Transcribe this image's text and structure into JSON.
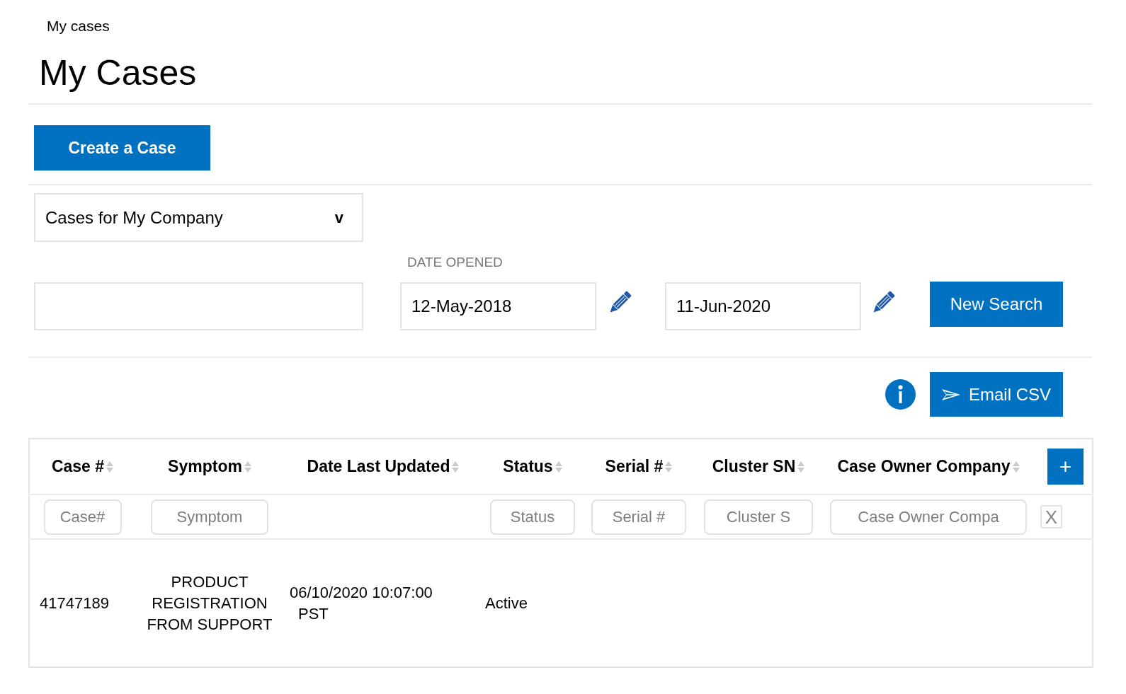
{
  "breadcrumb": "My cases",
  "page_title": "My Cases",
  "create_case_button": "Create a Case",
  "case_scope_dropdown": {
    "value": "Cases for My Company",
    "caret": "v"
  },
  "date_opened": {
    "label": "DATE OPENED",
    "from": "12-May-2018",
    "to": "11-Jun-2020"
  },
  "new_search_button": "New Search",
  "email_csv_button": "Email CSV",
  "table": {
    "columns": [
      {
        "label": "Case #",
        "filter_placeholder": "Case#"
      },
      {
        "label": "Symptom",
        "filter_placeholder": "Symptom"
      },
      {
        "label": "Date Last Updated"
      },
      {
        "label": "Status",
        "filter_placeholder": "Status"
      },
      {
        "label": "Serial #",
        "filter_placeholder": "Serial #"
      },
      {
        "label": "Cluster SN",
        "filter_placeholder": "Cluster S"
      },
      {
        "label": "Case Owner Company",
        "filter_placeholder": "Case Owner Compa"
      }
    ],
    "add_column_button": "+",
    "clear_filters_button": "X",
    "rows": [
      {
        "cells": [
          "41747189",
          "PRODUCT REGISTRATION FROM SUPPORT",
          "06/10/2020 10:07:00 PST",
          "Active"
        ]
      }
    ]
  }
}
